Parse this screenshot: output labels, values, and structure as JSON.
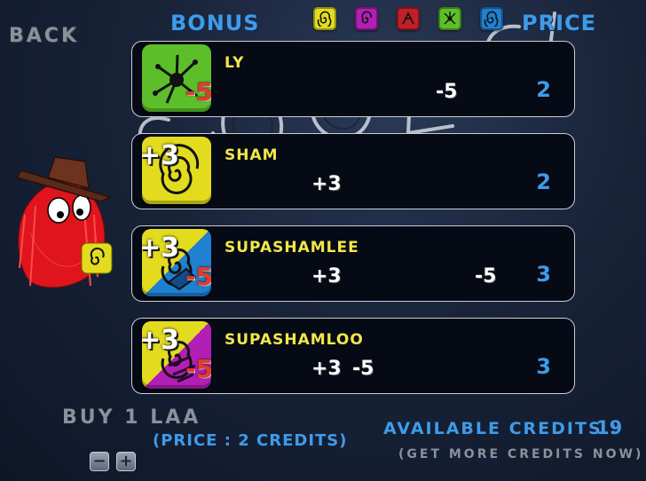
{
  "nav": {
    "back_label": "BACK"
  },
  "headers": {
    "bonus": "BONUS",
    "price": "PRICE"
  },
  "watermark_text": "COOLS!",
  "filters": [
    {
      "icon": "yellow-spiral-icon",
      "color": "#e3dc1e"
    },
    {
      "icon": "magenta-spiral-icon",
      "color": "#b11fb4"
    },
    {
      "icon": "red-shard-icon",
      "color": "#c0202a"
    },
    {
      "icon": "green-splat-icon",
      "color": "#5cbf2a"
    },
    {
      "icon": "blue-spiral-icon",
      "color": "#1f7fd0"
    }
  ],
  "items": [
    {
      "name": "LY",
      "overlay_plus": "",
      "overlay_minus": "-5",
      "stat_a": "",
      "stat_b": "",
      "stat_c": "-5",
      "price": "2"
    },
    {
      "name": "SHAM",
      "overlay_plus": "+3",
      "overlay_minus": "",
      "stat_a": "+3",
      "stat_b": "",
      "stat_c": "",
      "price": "2"
    },
    {
      "name": "SUPASHAMLEE",
      "overlay_plus": "+3",
      "overlay_minus": "-5",
      "stat_a": "+3",
      "stat_b": "",
      "stat_c": "-5",
      "price": "3"
    },
    {
      "name": "SUPASHAMLOO",
      "overlay_plus": "+3",
      "overlay_minus": "-5",
      "stat_a": "+3",
      "stat_b": "-5",
      "stat_c": "",
      "price": "3"
    }
  ],
  "purchase": {
    "buy_label": "BUY 1 LAA",
    "price_label": "(PRICE :  2 CREDITS)",
    "minus_label": "−",
    "plus_label": "+"
  },
  "credits": {
    "label": "AVAILABLE CREDITS :",
    "value": "19",
    "get_more": "(GET MORE CREDITS NOW)"
  },
  "colors": {
    "accent_blue": "#3f9be8",
    "name_yellow": "#f2e64a",
    "muted_gray": "#8a919c",
    "penalty_red": "#e63a2a"
  }
}
